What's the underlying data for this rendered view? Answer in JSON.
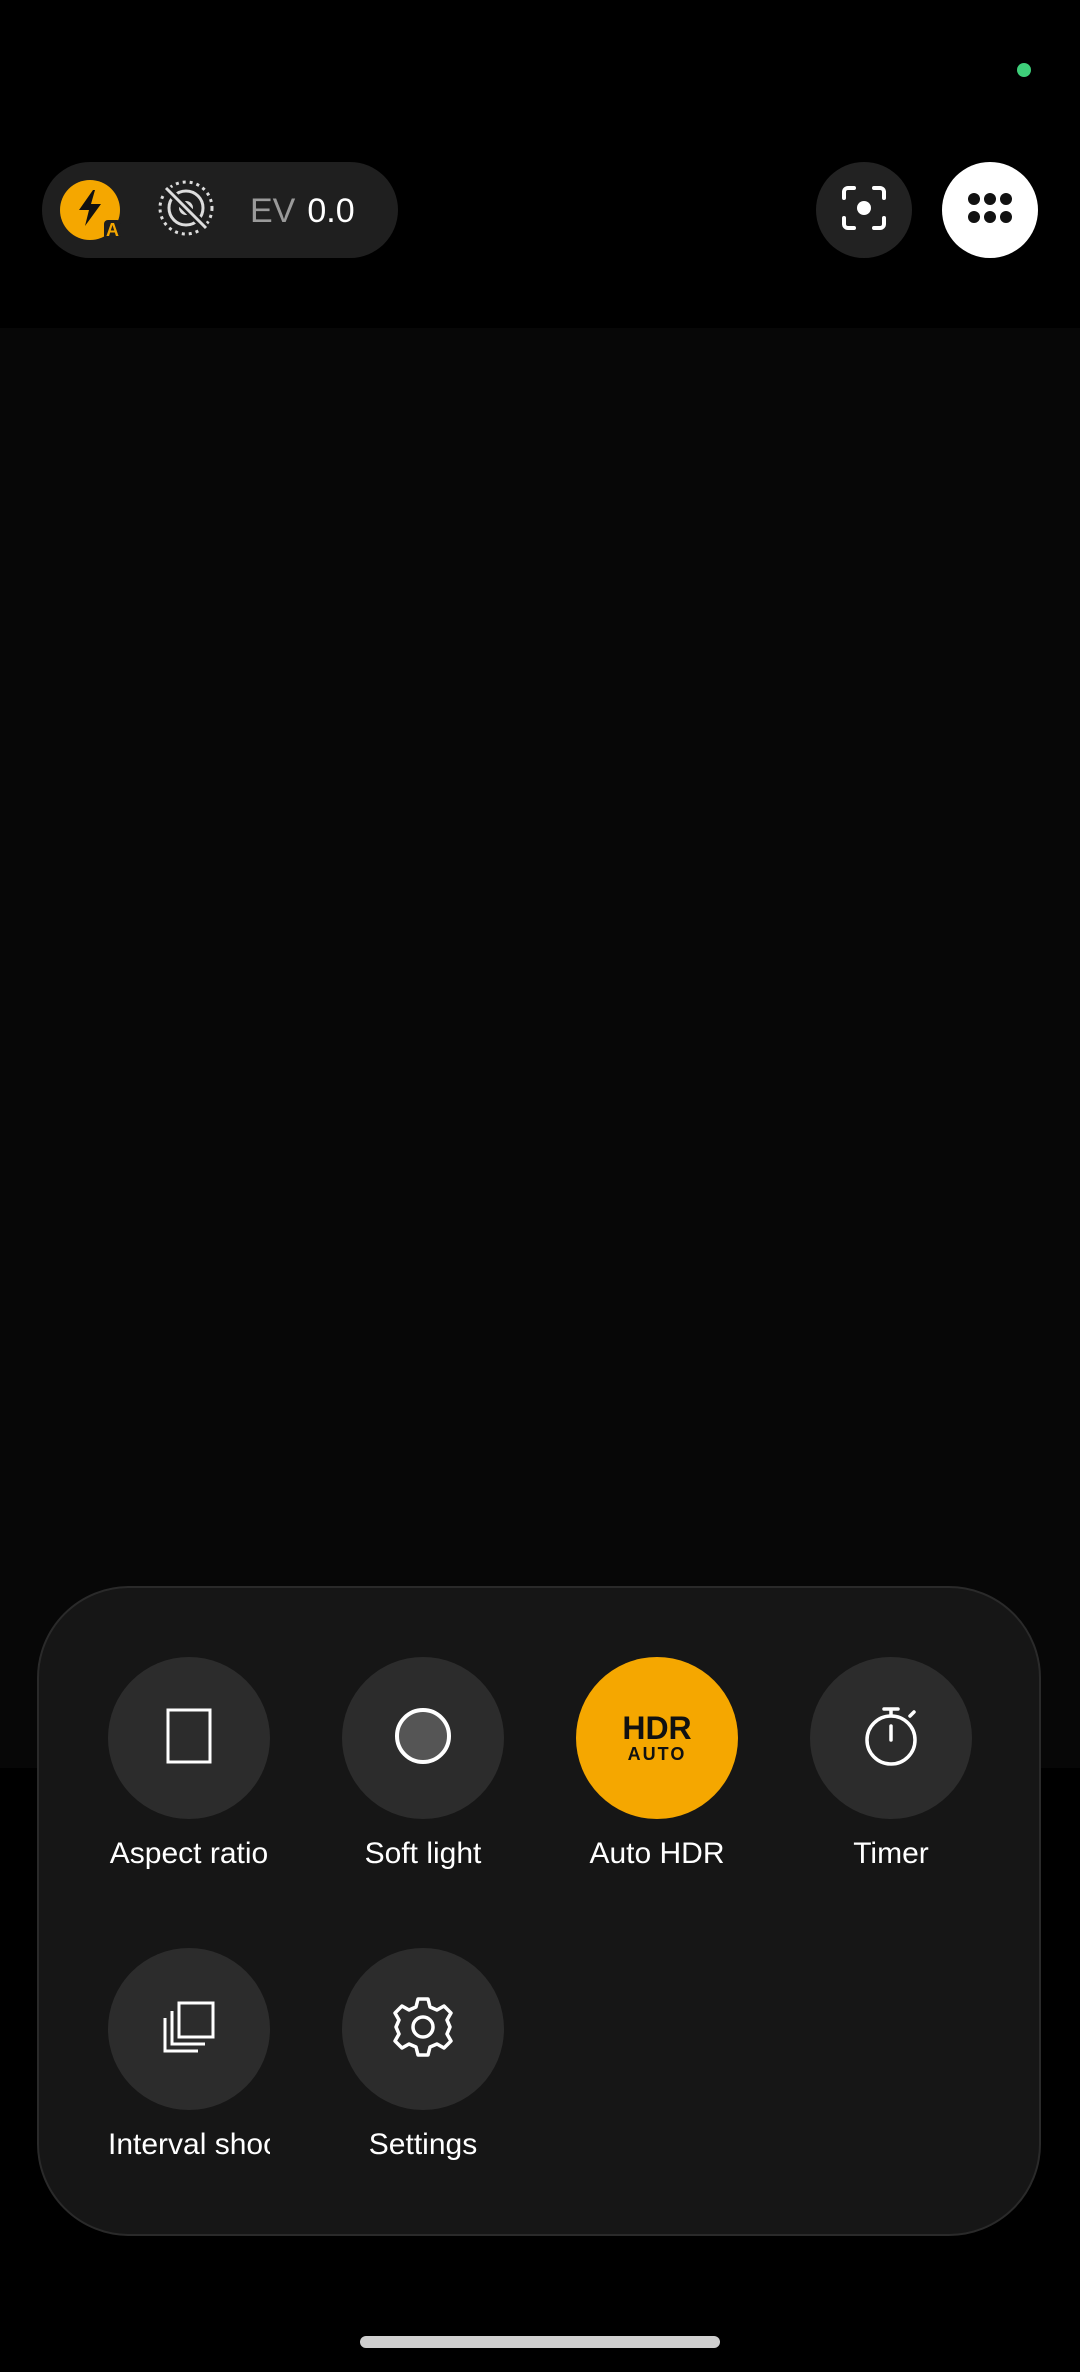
{
  "top_controls": {
    "flash_icon": "flash-auto-icon",
    "flash_badge": "A",
    "live_photo_icon": "live-photo-off-icon",
    "ev_label": "EV",
    "ev_value": "0.0",
    "focus_icon": "face-focus-icon",
    "more_icon": "more-grid-icon"
  },
  "options": [
    {
      "label": "Aspect ratio",
      "icon": "aspect-ratio-icon",
      "active": false
    },
    {
      "label": "Soft light",
      "icon": "soft-light-icon",
      "active": false
    },
    {
      "label": "Auto HDR",
      "icon": "hdr-auto-icon",
      "active": true,
      "icon_text": "HDR",
      "icon_subtext": "AUTO"
    },
    {
      "label": "Timer",
      "icon": "timer-icon",
      "active": false
    },
    {
      "label": "Interval shoo",
      "icon": "interval-shooting-icon",
      "active": false
    },
    {
      "label": "Settings",
      "icon": "settings-gear-icon",
      "active": false
    }
  ],
  "colors": {
    "accent": "#f5a700",
    "status_dot": "#3ecf7a"
  }
}
